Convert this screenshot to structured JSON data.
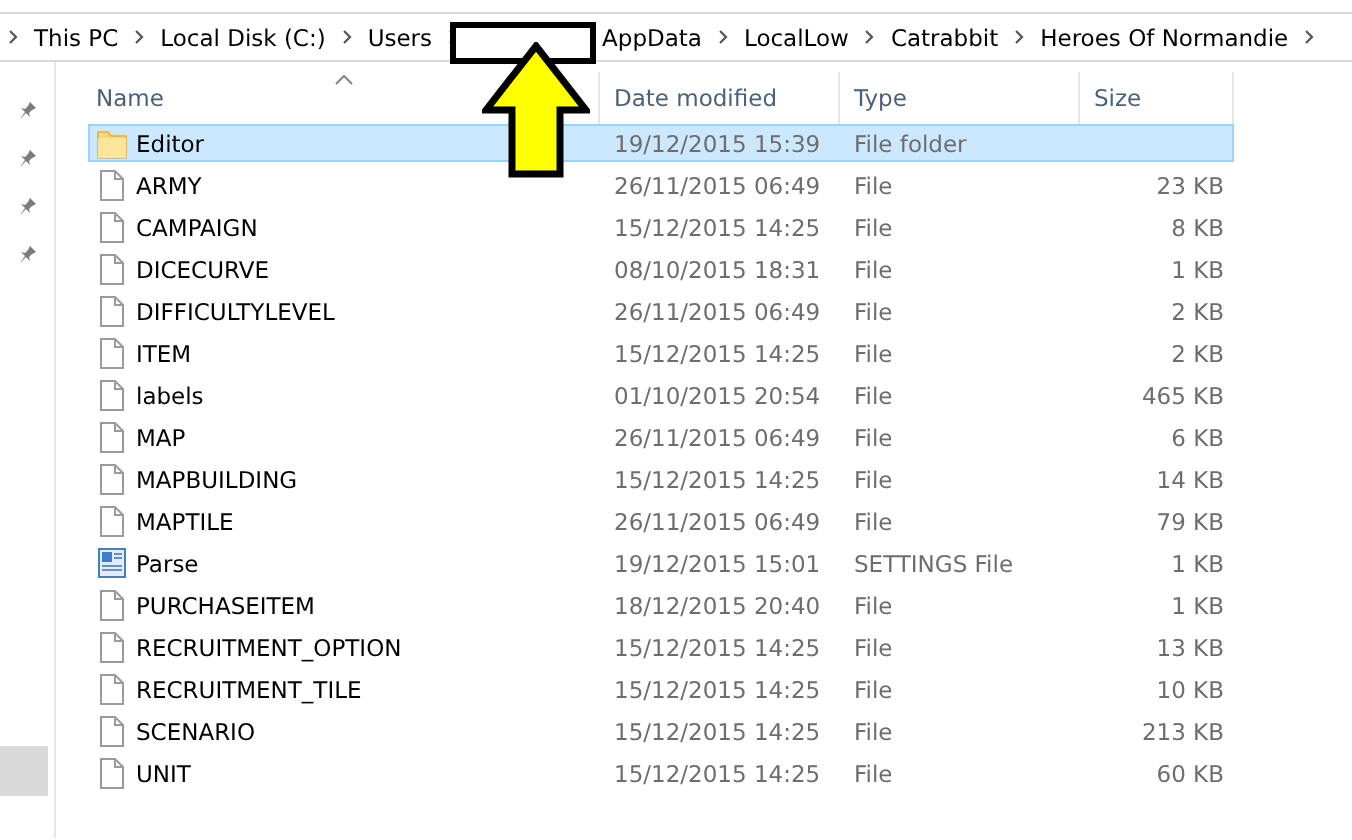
{
  "address_bar": {
    "items": [
      {
        "kind": "folder",
        "label": "This PC"
      },
      {
        "kind": "folder",
        "label": "Local Disk (C:)"
      },
      {
        "kind": "folder",
        "label": "Users"
      },
      {
        "kind": "redacted"
      },
      {
        "kind": "folder",
        "label": "AppData"
      },
      {
        "kind": "folder",
        "label": "LocalLow"
      },
      {
        "kind": "folder",
        "label": "Catrabbit"
      },
      {
        "kind": "folder",
        "label": "Heroes Of Normandie"
      }
    ]
  },
  "columns": [
    {
      "label": "Name",
      "sorted": true
    },
    {
      "label": "Date modified",
      "sorted": false
    },
    {
      "label": "Type",
      "sorted": false
    },
    {
      "label": "Size",
      "sorted": false
    }
  ],
  "rows": [
    {
      "name": "Editor",
      "date": "19/12/2015 15:39",
      "type": "File folder",
      "kind": "folder",
      "selected": true
    },
    {
      "name": "ARMY",
      "date": "26/11/2015 06:49",
      "type": "File",
      "size": "23 KB",
      "kind": "file",
      "selected": false
    },
    {
      "name": "CAMPAIGN",
      "date": "15/12/2015 14:25",
      "type": "File",
      "size": "8 KB",
      "kind": "file",
      "selected": false
    },
    {
      "name": "DICECURVE",
      "date": "08/10/2015 18:31",
      "type": "File",
      "size": "1 KB",
      "kind": "file",
      "selected": false
    },
    {
      "name": "DIFFICULTYLEVEL",
      "date": "26/11/2015 06:49",
      "type": "File",
      "size": "2 KB",
      "kind": "file",
      "selected": false
    },
    {
      "name": "ITEM",
      "date": "15/12/2015 14:25",
      "type": "File",
      "size": "2 KB",
      "kind": "file",
      "selected": false
    },
    {
      "name": "labels",
      "date": "01/10/2015 20:54",
      "type": "File",
      "size": "465 KB",
      "kind": "file",
      "selected": false
    },
    {
      "name": "MAP",
      "date": "26/11/2015 06:49",
      "type": "File",
      "size": "6 KB",
      "kind": "file",
      "selected": false
    },
    {
      "name": "MAPBUILDING",
      "date": "15/12/2015 14:25",
      "type": "File",
      "size": "14 KB",
      "kind": "file",
      "selected": false
    },
    {
      "name": "MAPTILE",
      "date": "26/11/2015 06:49",
      "type": "File",
      "size": "79 KB",
      "kind": "file",
      "selected": false
    },
    {
      "name": "Parse",
      "date": "19/12/2015 15:01",
      "type": "SETTINGS File",
      "size": "1 KB",
      "kind": "settings",
      "selected": false
    },
    {
      "name": "PURCHASEITEM",
      "date": "18/12/2015 20:40",
      "type": "File",
      "size": "1 KB",
      "kind": "file",
      "selected": false
    },
    {
      "name": "RECRUITMENT_OPTION",
      "date": "15/12/2015 14:25",
      "type": "File",
      "size": "13 KB",
      "kind": "file",
      "selected": false
    },
    {
      "name": "RECRUITMENT_TILE",
      "date": "15/12/2015 14:25",
      "type": "File",
      "size": "10 KB",
      "kind": "file",
      "selected": false
    },
    {
      "name": "SCENARIO",
      "date": "15/12/2015 14:25",
      "type": "File",
      "size": "213 KB",
      "kind": "file",
      "selected": false
    },
    {
      "name": "UNIT",
      "date": "15/12/2015 14:25",
      "type": "File",
      "size": "60 KB",
      "kind": "file",
      "selected": false
    }
  ]
}
